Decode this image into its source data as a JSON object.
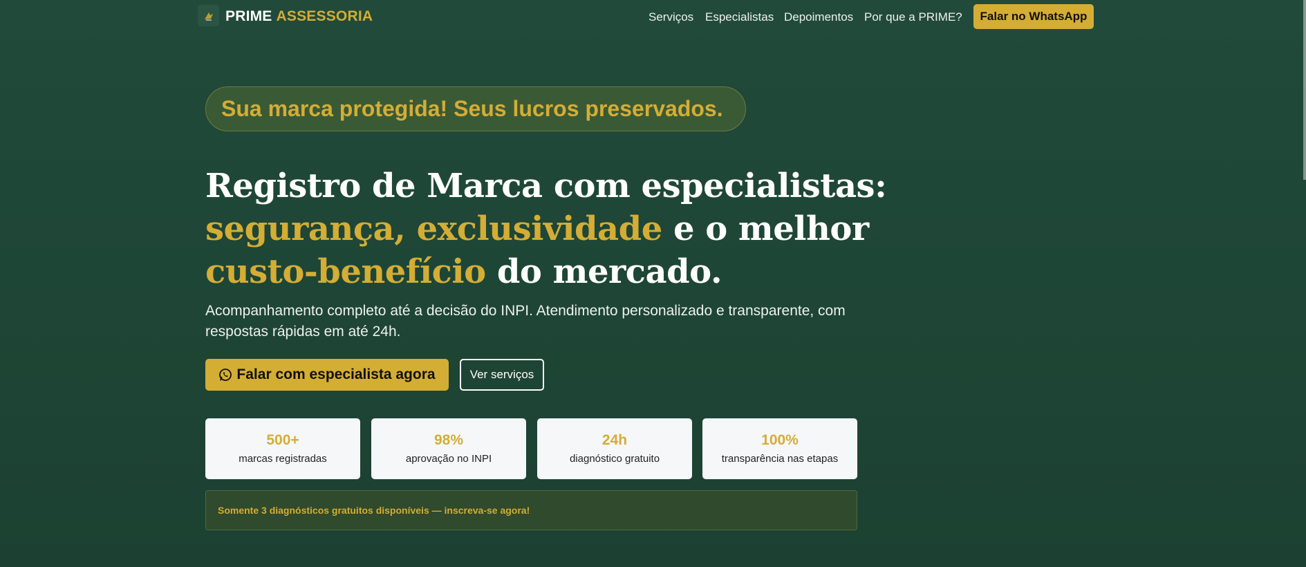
{
  "header": {
    "brand_prime": "PRIME",
    "brand_assessoria": "ASSESSORIA",
    "nav": [
      "Serviços",
      "Especialistas",
      "Depoimentos",
      "Por que a PRIME?"
    ],
    "whatsapp_button": "Falar no WhatsApp"
  },
  "hero": {
    "tagline": "Sua marca protegida! Seus lucros preservados.",
    "headline": {
      "line1": "Registro de Marca com especialistas:",
      "line2_gold": "segurança, exclusividade",
      "line2_rest": " e o melhor",
      "line3_gold": "custo-benefício",
      "line3_rest": " do mercado."
    },
    "subtitle": "Acompanhamento completo até a decisão do INPI. Atendimento personalizado e transparente, com respostas rápidas em até 24h.",
    "cta_primary": "Falar com especialista agora",
    "cta_secondary": "Ver serviços"
  },
  "stats": [
    {
      "value": "500+",
      "label": "marcas registradas"
    },
    {
      "value": "98%",
      "label": "aprovação no INPI"
    },
    {
      "value": "24h",
      "label": "diagnóstico gratuito"
    },
    {
      "value": "100%",
      "label": "transparência nas etapas"
    }
  ],
  "notice": "Somente 3 diagnósticos gratuitos disponíveis — inscreva-se agora!",
  "colors": {
    "accent_gold": "#d4ad35",
    "background_green": "#214a3a"
  },
  "icons": [
    "brand-logo-icon",
    "whatsapp-icon"
  ]
}
